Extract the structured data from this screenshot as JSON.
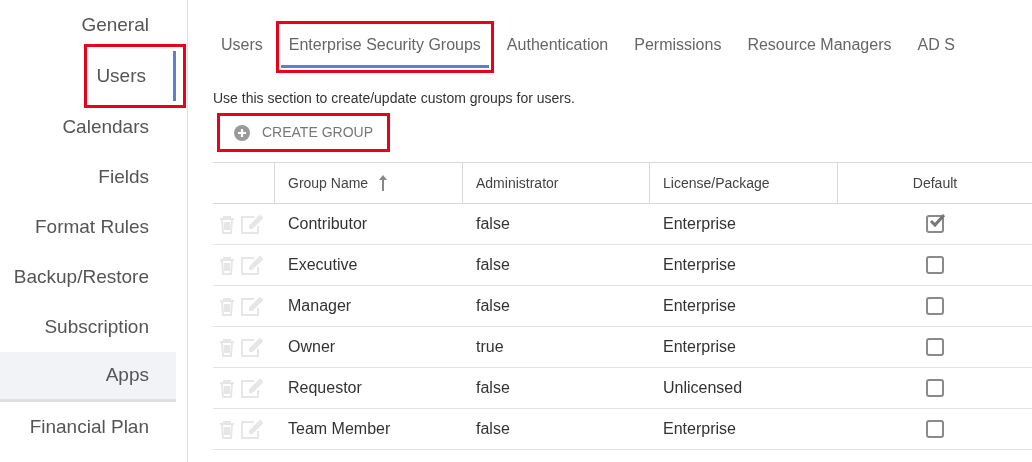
{
  "sidebar": {
    "items": [
      {
        "label": "General",
        "selected": false,
        "highlighted": false,
        "hovered": false
      },
      {
        "label": "Users",
        "selected": true,
        "highlighted": true,
        "hovered": false
      },
      {
        "label": "Calendars",
        "selected": false,
        "highlighted": false,
        "hovered": false
      },
      {
        "label": "Fields",
        "selected": false,
        "highlighted": false,
        "hovered": false
      },
      {
        "label": "Format Rules",
        "selected": false,
        "highlighted": false,
        "hovered": false
      },
      {
        "label": "Backup/Restore",
        "selected": false,
        "highlighted": false,
        "hovered": false
      },
      {
        "label": "Subscription",
        "selected": false,
        "highlighted": false,
        "hovered": false
      },
      {
        "label": "Apps",
        "selected": false,
        "highlighted": false,
        "hovered": true
      },
      {
        "label": "Financial Plan",
        "selected": false,
        "highlighted": false,
        "hovered": false
      }
    ]
  },
  "tabs": [
    {
      "label": "Users",
      "selected": false,
      "highlighted": false
    },
    {
      "label": "Enterprise Security Groups",
      "selected": true,
      "highlighted": true
    },
    {
      "label": "Authentication",
      "selected": false,
      "highlighted": false
    },
    {
      "label": "Permissions",
      "selected": false,
      "highlighted": false
    },
    {
      "label": "Resource Managers",
      "selected": false,
      "highlighted": false
    },
    {
      "label": "AD S",
      "selected": false,
      "highlighted": false
    }
  ],
  "description": "Use this section to create/update custom groups for users.",
  "create_button": {
    "label": "CREATE GROUP",
    "highlighted": true
  },
  "table": {
    "columns": [
      {
        "label": "Group Name",
        "sorted": true
      },
      {
        "label": "Administrator",
        "sorted": false
      },
      {
        "label": "License/Package",
        "sorted": false
      },
      {
        "label": "Default",
        "sorted": false
      }
    ],
    "rows": [
      {
        "group_name": "Contributor",
        "administrator": "false",
        "license": "Enterprise",
        "default": true
      },
      {
        "group_name": "Executive",
        "administrator": "false",
        "license": "Enterprise",
        "default": false
      },
      {
        "group_name": "Manager",
        "administrator": "false",
        "license": "Enterprise",
        "default": false
      },
      {
        "group_name": "Owner",
        "administrator": "true",
        "license": "Enterprise",
        "default": false
      },
      {
        "group_name": "Requestor",
        "administrator": "false",
        "license": "Unlicensed",
        "default": false
      },
      {
        "group_name": "Team Member",
        "administrator": "false",
        "license": "Enterprise",
        "default": false
      }
    ]
  }
}
